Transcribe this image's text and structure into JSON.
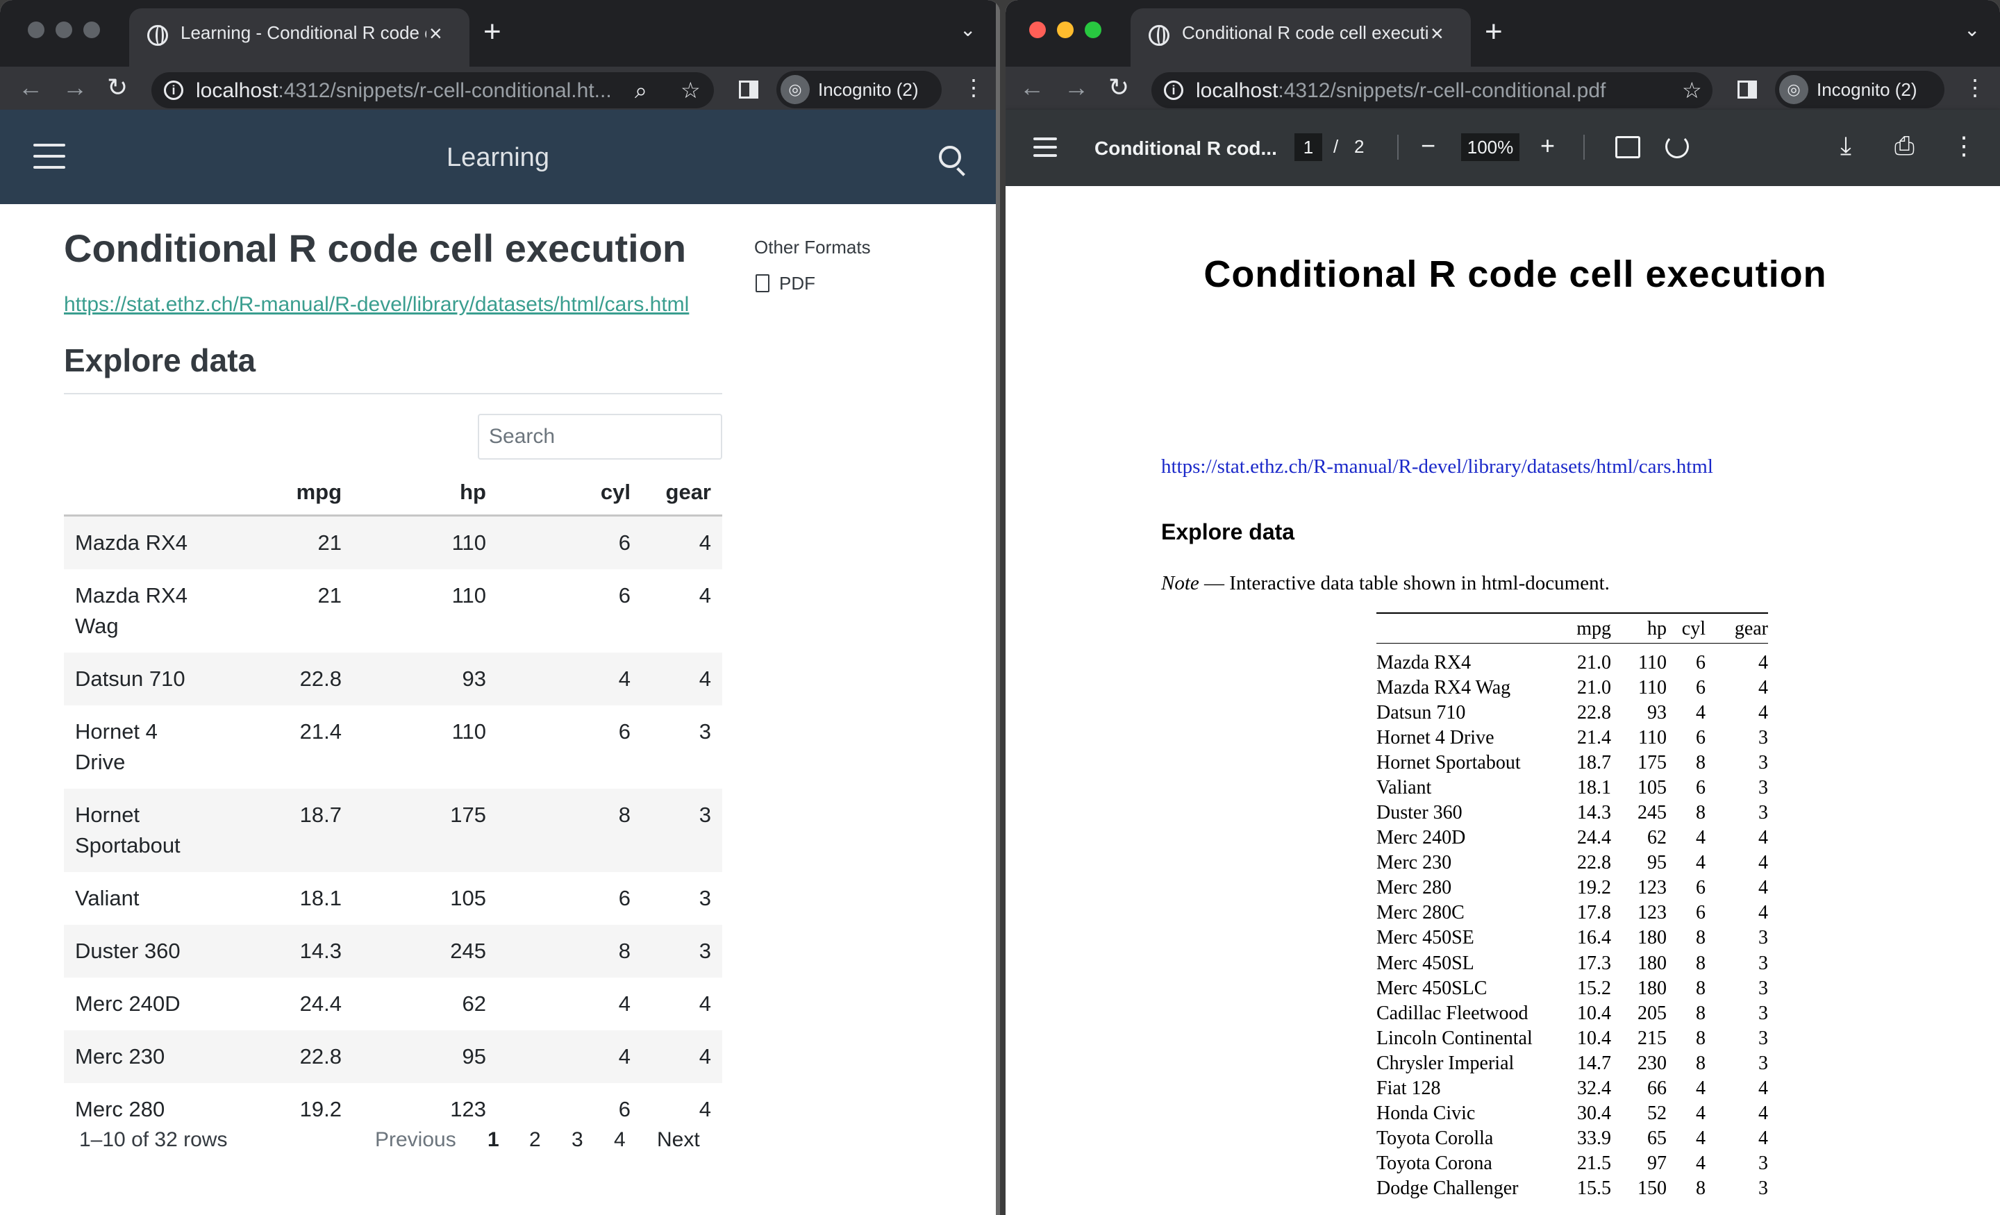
{
  "left_window": {
    "tab_title": "Learning - Conditional R code c",
    "url_host": "localhost",
    "url_rest": ":4312/snippets/r-cell-conditional.ht...",
    "incognito_label": "Incognito (2)",
    "site": {
      "brand": "Learning",
      "title": "Conditional R code cell execution",
      "link": "https://stat.ethz.ch/R-manual/R-devel/library/datasets/html/cars.html",
      "section": "Explore data",
      "other_formats": "Other Formats",
      "pdf_label": "PDF",
      "search_placeholder": "Search",
      "columns": [
        "",
        "mpg",
        "hp",
        "cyl",
        "gear"
      ],
      "rows": [
        [
          "Mazda RX4",
          "21",
          "110",
          "6",
          "4"
        ],
        [
          "Mazda RX4 Wag",
          "21",
          "110",
          "6",
          "4"
        ],
        [
          "Datsun 710",
          "22.8",
          "93",
          "4",
          "4"
        ],
        [
          "Hornet 4 Drive",
          "21.4",
          "110",
          "6",
          "3"
        ],
        [
          "Hornet Sportabout",
          "18.7",
          "175",
          "8",
          "3"
        ],
        [
          "Valiant",
          "18.1",
          "105",
          "6",
          "3"
        ],
        [
          "Duster 360",
          "14.3",
          "245",
          "8",
          "3"
        ],
        [
          "Merc 240D",
          "24.4",
          "62",
          "4",
          "4"
        ],
        [
          "Merc 230",
          "22.8",
          "95",
          "4",
          "4"
        ],
        [
          "Merc 280",
          "19.2",
          "123",
          "6",
          "4"
        ]
      ],
      "info": "1–10 of 32 rows",
      "pager": {
        "previous": "Previous",
        "pages": [
          "1",
          "2",
          "3",
          "4"
        ],
        "current": "1",
        "next": "Next"
      }
    }
  },
  "right_window": {
    "tab_title": "Conditional R code cell executi",
    "url_host": "localhost",
    "url_rest": ":4312/snippets/r-cell-conditional.pdf",
    "incognito_label": "Incognito (2)",
    "viewer": {
      "title": "Conditional R cod...",
      "page_current": "1",
      "page_sep": "/",
      "page_total": "2",
      "zoom": "100%"
    },
    "doc": {
      "title": "Conditional R code cell execution",
      "link": "https://stat.ethz.ch/R-manual/R-devel/library/datasets/html/cars.html",
      "section": "Explore data",
      "note_label": "Note",
      "note_text": " — Interactive data table shown in html-document.",
      "columns": [
        "",
        "mpg",
        "hp",
        "cyl",
        "gear"
      ],
      "rows": [
        [
          "Mazda RX4",
          "21.0",
          "110",
          "6",
          "4"
        ],
        [
          "Mazda RX4 Wag",
          "21.0",
          "110",
          "6",
          "4"
        ],
        [
          "Datsun 710",
          "22.8",
          "93",
          "4",
          "4"
        ],
        [
          "Hornet 4 Drive",
          "21.4",
          "110",
          "6",
          "3"
        ],
        [
          "Hornet Sportabout",
          "18.7",
          "175",
          "8",
          "3"
        ],
        [
          "Valiant",
          "18.1",
          "105",
          "6",
          "3"
        ],
        [
          "Duster 360",
          "14.3",
          "245",
          "8",
          "3"
        ],
        [
          "Merc 240D",
          "24.4",
          "62",
          "4",
          "4"
        ],
        [
          "Merc 230",
          "22.8",
          "95",
          "4",
          "4"
        ],
        [
          "Merc 280",
          "19.2",
          "123",
          "6",
          "4"
        ],
        [
          "Merc 280C",
          "17.8",
          "123",
          "6",
          "4"
        ],
        [
          "Merc 450SE",
          "16.4",
          "180",
          "8",
          "3"
        ],
        [
          "Merc 450SL",
          "17.3",
          "180",
          "8",
          "3"
        ],
        [
          "Merc 450SLC",
          "15.2",
          "180",
          "8",
          "3"
        ],
        [
          "Cadillac Fleetwood",
          "10.4",
          "205",
          "8",
          "3"
        ],
        [
          "Lincoln Continental",
          "10.4",
          "215",
          "8",
          "3"
        ],
        [
          "Chrysler Imperial",
          "14.7",
          "230",
          "8",
          "3"
        ],
        [
          "Fiat 128",
          "32.4",
          "66",
          "4",
          "4"
        ],
        [
          "Honda Civic",
          "30.4",
          "52",
          "4",
          "4"
        ],
        [
          "Toyota Corolla",
          "33.9",
          "65",
          "4",
          "4"
        ],
        [
          "Toyota Corona",
          "21.5",
          "97",
          "4",
          "3"
        ],
        [
          "Dodge Challenger",
          "15.5",
          "150",
          "8",
          "3"
        ]
      ]
    }
  },
  "icons": {
    "tab_close": "×",
    "new_tab": "+",
    "tab_menu": "⌄",
    "back": "←",
    "forward": "→",
    "reload": "↻",
    "info": "i",
    "zoom_lens": "⌕",
    "star": "☆",
    "incognito": "◎",
    "kebab": "⋮",
    "minus": "−",
    "plus": "+",
    "download": "⤓",
    "print": "⎙"
  },
  "colors": {
    "chrome_dark": "#202124",
    "chrome_toolbar": "#35363a",
    "site_navbar": "#2c3e50",
    "link_teal": "#3a9e8f",
    "pdf_toolbar": "#323639",
    "pdf_link_blue": "#1a28c9",
    "traffic_red": "#ff5f57",
    "traffic_yellow": "#febc2e",
    "traffic_green": "#28c840"
  }
}
